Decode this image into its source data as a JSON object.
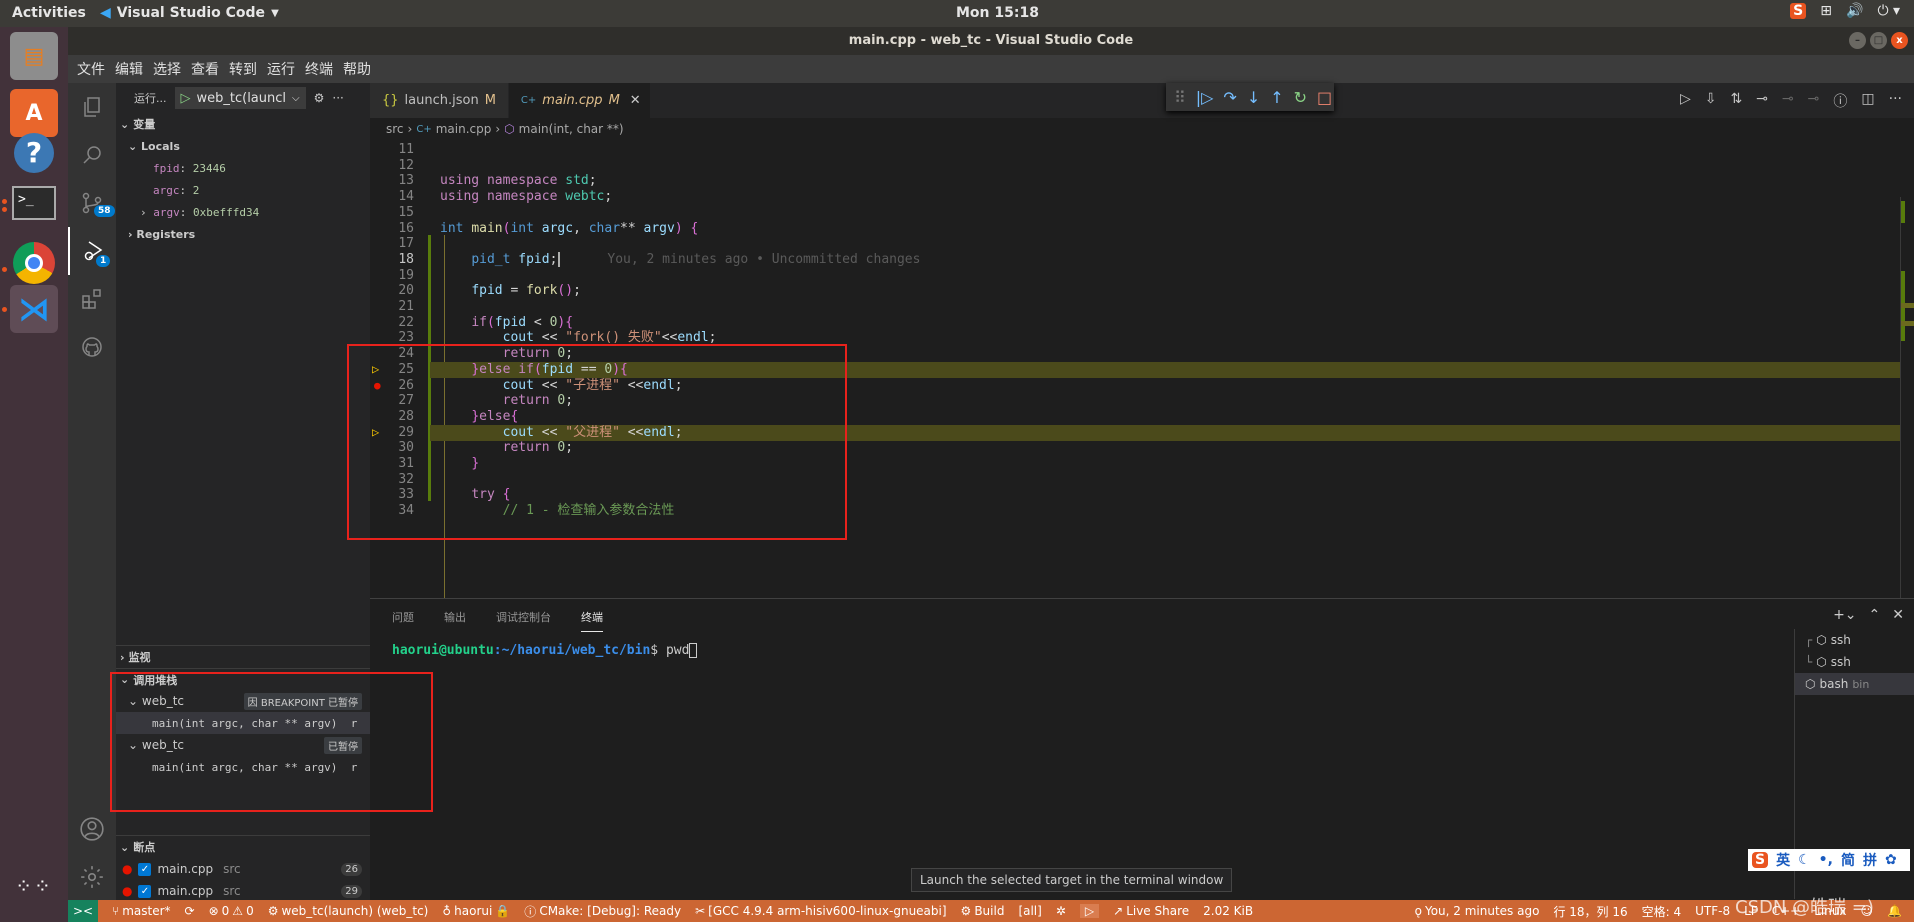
{
  "topbar": {
    "activities": "Activities",
    "app_name": "Visual Studio Code",
    "clock": "Mon 15:18"
  },
  "window": {
    "title": "main.cpp - web_tc - Visual Studio Code"
  },
  "menu": [
    "文件",
    "编辑",
    "选择",
    "查看",
    "转到",
    "运行",
    "终端",
    "帮助"
  ],
  "activity_bar": {
    "scm_badge": "58",
    "debug_badge": "1"
  },
  "sidebar": {
    "run_label": "运行...",
    "debug_config": "web_tc(launcl",
    "variables_title": "变量",
    "locals_title": "Locals",
    "locals": [
      {
        "name": "fpid",
        "value": "23446"
      },
      {
        "name": "argc",
        "value": "2"
      },
      {
        "name": "argv",
        "value": "0xbefffd34"
      }
    ],
    "registers_title": "Registers",
    "watch_title": "监视",
    "callstack_title": "调用堆栈",
    "callstack": [
      {
        "thread": "web_tc",
        "status": "因 BREAKPOINT 已暂停",
        "frame": "main(int argc, char ** argv)",
        "frame_suffix": "r"
      },
      {
        "thread": "web_tc",
        "status": "已暂停",
        "frame": "main(int argc, char ** argv)",
        "frame_suffix": "r"
      }
    ],
    "breakpoints_title": "断点",
    "breakpoints": [
      {
        "file": "main.cpp",
        "dir": "src",
        "line": "26"
      },
      {
        "file": "main.cpp",
        "dir": "src",
        "line": "29"
      }
    ]
  },
  "editor": {
    "tabs": [
      {
        "icon": "{}",
        "label": "launch.json",
        "status": "M"
      },
      {
        "icon": "C+",
        "label": "main.cpp",
        "status": "M"
      }
    ],
    "breadcrumb": [
      "src",
      "main.cpp",
      "main(int, char **)"
    ],
    "blame": "You, 2 minutes ago • Uncommitted changes",
    "lines": [
      {
        "n": "11",
        "t": ""
      },
      {
        "n": "12",
        "t": ""
      },
      {
        "n": "13",
        "t": "using namespace std;"
      },
      {
        "n": "14",
        "t": "using namespace webtc;"
      },
      {
        "n": "15",
        "t": ""
      },
      {
        "n": "16",
        "t": "int main(int argc, char** argv) {"
      },
      {
        "n": "17",
        "t": ""
      },
      {
        "n": "18",
        "t": "    pid_t fpid;"
      },
      {
        "n": "19",
        "t": ""
      },
      {
        "n": "20",
        "t": "    fpid = fork();"
      },
      {
        "n": "21",
        "t": ""
      },
      {
        "n": "22",
        "t": "    if(fpid < 0){"
      },
      {
        "n": "23",
        "t": "        cout << \"fork() 失败\"<<endl;"
      },
      {
        "n": "24",
        "t": "        return 0;"
      },
      {
        "n": "25",
        "t": "    }else if(fpid == 0){"
      },
      {
        "n": "26",
        "t": "        cout << \"子进程\" <<endl;"
      },
      {
        "n": "27",
        "t": "        return 0;"
      },
      {
        "n": "28",
        "t": "    }else{"
      },
      {
        "n": "29",
        "t": "        cout << \"父进程\" <<endl;"
      },
      {
        "n": "30",
        "t": "        return 0;"
      },
      {
        "n": "31",
        "t": "    }"
      },
      {
        "n": "32",
        "t": ""
      },
      {
        "n": "33",
        "t": "    try {"
      },
      {
        "n": "34",
        "t": "        // 1 - 检查输入参数合法性"
      }
    ]
  },
  "panel": {
    "tabs": [
      "问题",
      "输出",
      "调试控制台",
      "终端"
    ],
    "active_tab": "终端",
    "prompt_user": "haorui@ubuntu",
    "prompt_path": ":~/haorui/web_tc/bin",
    "prompt_symbol": "$ ",
    "command": "pwd",
    "terminals": [
      {
        "label": "ssh",
        "sub": ""
      },
      {
        "label": "ssh",
        "sub": ""
      },
      {
        "label": "bash",
        "sub": "bin"
      }
    ]
  },
  "tooltip": "Launch the selected target in the terminal window",
  "statusbar": {
    "branch": "master*",
    "errors": "0",
    "warnings": "0",
    "debug_target": "web_tc(launch) (web_tc)",
    "user": "haorui",
    "cmake": "CMake: [Debug]: Ready",
    "kit": "[GCC 4.9.4 arm-hisiv600-linux-gnueabi]",
    "build": "Build",
    "build_target": "[all]",
    "live_share": "Live Share",
    "size": "2.02 KiB",
    "blame": "You, 2 minutes ago",
    "position": "行 18，列 16",
    "spaces": "空格: 4",
    "encoding": "UTF-8",
    "eol": "LF",
    "language": "C++",
    "os": "Linux"
  },
  "ime": {
    "lang": "英",
    "mode1": "简",
    "mode2": "拼"
  },
  "watermark": "CSDN @皓瑞 =)"
}
